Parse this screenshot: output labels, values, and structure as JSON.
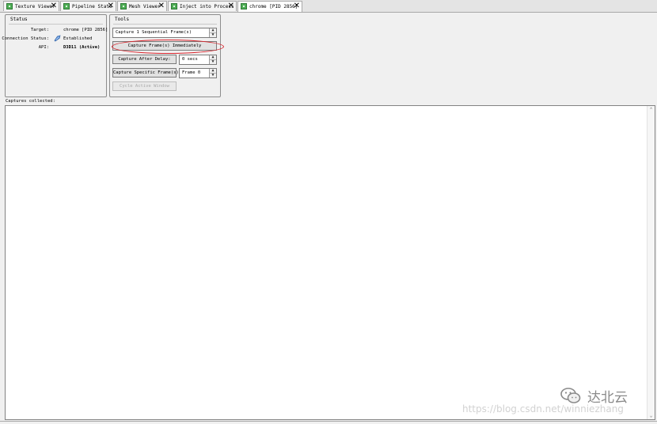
{
  "tabs": [
    {
      "label": "Texture Viewer",
      "active": false
    },
    {
      "label": "Pipeline State",
      "active": false
    },
    {
      "label": "Mesh Viewer",
      "active": false
    },
    {
      "label": "Inject into Process",
      "active": false
    },
    {
      "label": "chrome [PID 2856]",
      "active": true
    }
  ],
  "tab_close_glyph": "✕",
  "status": {
    "title": "Status",
    "target_label": "Target:",
    "target_value": "chrome [PID 2856]",
    "connection_label": "Connection Status:",
    "connection_value": "Established",
    "api_label": "API:",
    "api_value": "D3D11 (Active)"
  },
  "tools": {
    "title": "Tools",
    "sequential_value": "Capture 1 Sequential Frame(s)",
    "capture_now_label": "Capture Frame(s) Immediately",
    "capture_delay_label": "Capture After Delay:",
    "delay_value": "0 secs",
    "capture_specific_label": "Capture Specific Frame(s)",
    "specific_value": "Frame 0",
    "cycle_label": "Cycle Active Window"
  },
  "captures": {
    "label": "Captures collected:"
  },
  "watermark": {
    "brand": "达北云",
    "url": "https://blog.csdn.net/winniezhang"
  },
  "colors": {
    "highlight": "#d9252d",
    "tab_icon": "#4fae56"
  }
}
